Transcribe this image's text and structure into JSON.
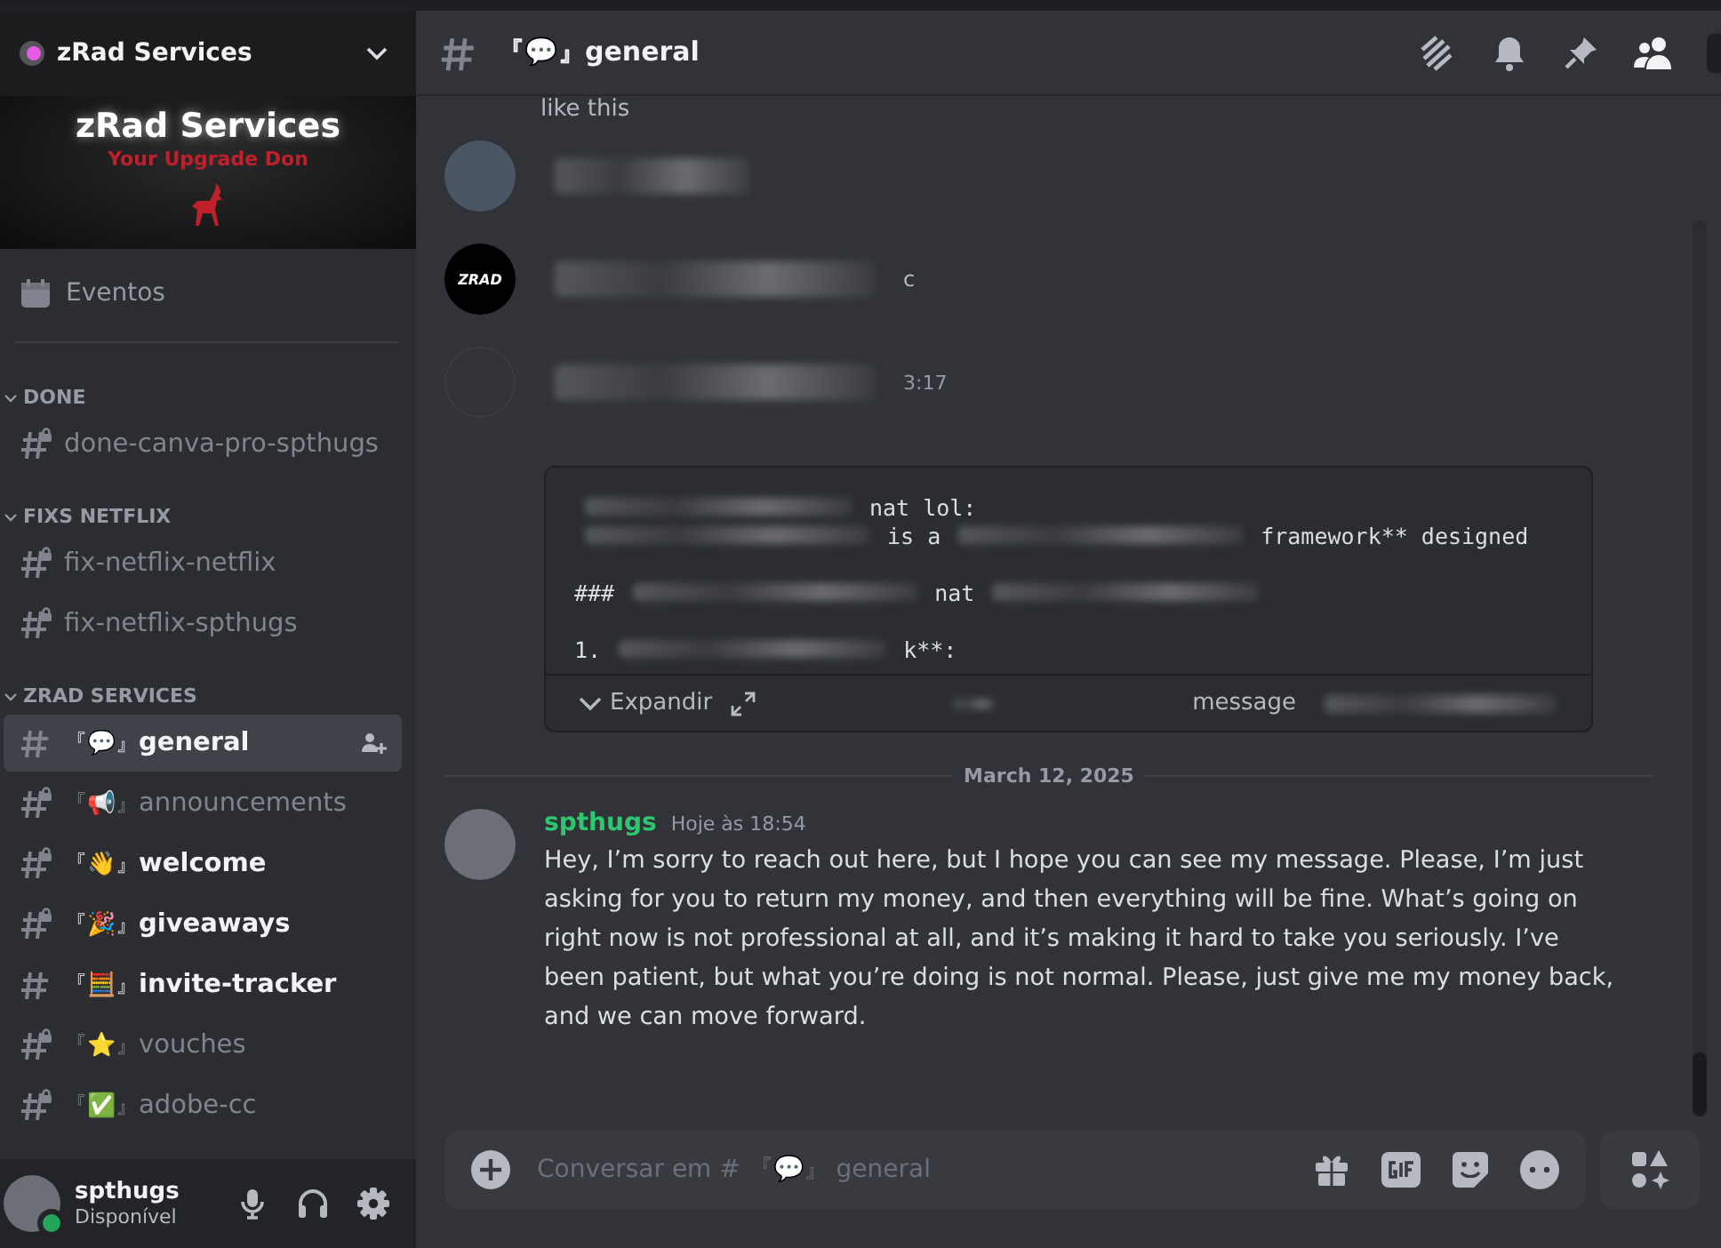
{
  "server": {
    "name": "zRad Services",
    "banner_title": "zRad Services",
    "banner_subtitle": "Your Upgrade Don"
  },
  "events_label": "Eventos",
  "categories": [
    {
      "name": "DONE",
      "expanded": true,
      "channels": [
        {
          "name": "done-canva-pro-spthugs",
          "locked": true,
          "unread": false,
          "selected": false
        }
      ]
    },
    {
      "name": "FIXS NETFLIX",
      "expanded": true,
      "channels": [
        {
          "name": "fix-netflix-netflix",
          "locked": true,
          "unread": false,
          "selected": false
        },
        {
          "name": "fix-netflix-spthugs",
          "locked": true,
          "unread": false,
          "selected": false
        }
      ]
    },
    {
      "name": "ZRAD SERVICES",
      "expanded": true,
      "channels": [
        {
          "prefix": "『💬』",
          "name": "general",
          "locked": false,
          "unread": true,
          "selected": true
        },
        {
          "prefix": "『📢』",
          "name": "announcements",
          "locked": true,
          "unread": false,
          "selected": false
        },
        {
          "prefix": "『👋』",
          "name": "welcome",
          "locked": true,
          "unread": true,
          "selected": false
        },
        {
          "prefix": "『🎉』",
          "name": "giveaways",
          "locked": true,
          "unread": true,
          "selected": false
        },
        {
          "prefix": "『🧮』",
          "name": "invite-tracker",
          "locked": false,
          "unread": true,
          "selected": false
        },
        {
          "prefix": "『⭐』",
          "name": "vouches",
          "locked": true,
          "unread": false,
          "selected": false
        },
        {
          "prefix": "『✅』",
          "name": "adobe-cc",
          "locked": true,
          "unread": false,
          "selected": false
        }
      ]
    }
  ],
  "user": {
    "name": "spthugs",
    "status": "Disponível",
    "online": true
  },
  "header": {
    "channel": "『💬』general"
  },
  "messages": [
    {
      "kind": "fragment",
      "text": "like this"
    },
    {
      "kind": "blurred_photo"
    },
    {
      "kind": "blurred_logo",
      "logo_text": "ZRAD",
      "text": "c"
    },
    {
      "kind": "blurred_empty",
      "time": "3:17"
    },
    {
      "kind": "code",
      "lines": [
        [
          {
            "kind": "blur-m"
          },
          {
            "kind": "text",
            "text": "nat lol:"
          }
        ],
        [
          {
            "kind": "blur-l"
          },
          {
            "kind": "text",
            "text": "is a"
          },
          {
            "kind": "blur-l"
          },
          {
            "kind": "text",
            "text": "framework** designed"
          }
        ],
        [
          {
            "kind": "text",
            "text": "###"
          },
          {
            "kind": "blur-l"
          },
          {
            "kind": "text",
            "text": "nat"
          },
          {
            "kind": "blur-m"
          }
        ],
        [
          {
            "kind": "text",
            "text": "1."
          },
          {
            "kind": "blur-m"
          },
          {
            "kind": "text",
            "text": "k**:"
          }
        ]
      ],
      "expand": "Expandir",
      "footer": "message"
    },
    {
      "kind": "divider",
      "text": "March 12, 2025"
    },
    {
      "kind": "message",
      "author": "spthugs",
      "time": "Hoje às 18:54",
      "text": "Hey, I’m sorry to reach out here, but I hope you can see my message. Please, I’m just asking for you to return my money, and then everything will be fine. What’s going on right now is not professional at all, and it’s making it hard to take you seriously. I’ve been patient, but what you’re doing is not normal. Please, just give me my money back, and we can move forward."
    }
  ],
  "composer": {
    "placeholder": "Conversar em # 『💬』 general"
  }
}
